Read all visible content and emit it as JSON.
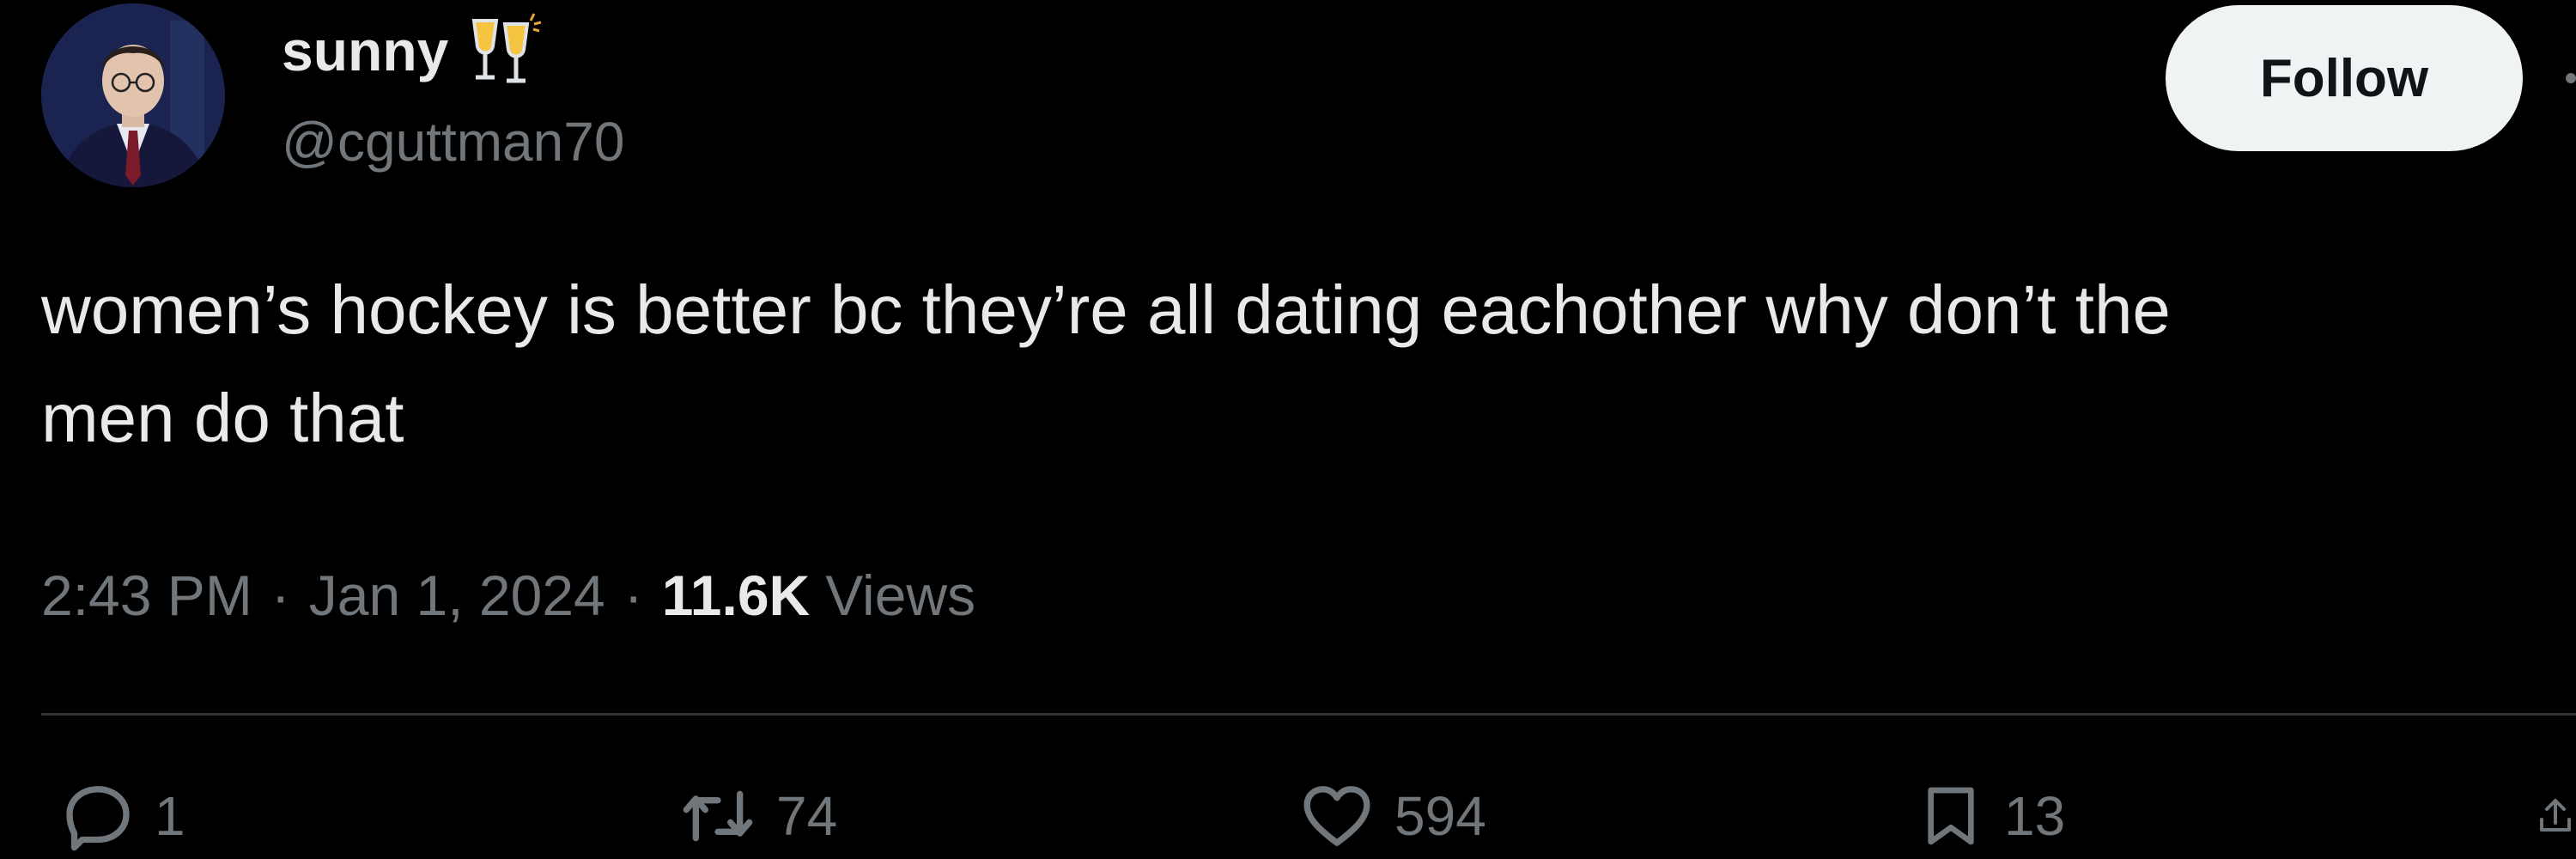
{
  "author": {
    "display_name": "sunny",
    "display_name_emoji": "clinking-glasses-emoji",
    "handle": "@cguttman70",
    "avatar": "profile-photo"
  },
  "follow_button": {
    "label": "Follow"
  },
  "tweet": {
    "text": "women’s hockey is better bc they’re all dating eachother why don’t the\nmen do that"
  },
  "meta": {
    "time": "2:43 PM",
    "separator": "·",
    "date": "Jan 1, 2024",
    "views_count": "11.6K",
    "views_label": "Views"
  },
  "actions": {
    "reply": {
      "icon": "reply-icon",
      "count": "1"
    },
    "retweet": {
      "icon": "retweet-icon",
      "count": "74"
    },
    "like": {
      "icon": "heart-icon",
      "count": "594"
    },
    "bookmark": {
      "icon": "bookmark-icon",
      "count": "13"
    },
    "share": {
      "icon": "share-icon"
    }
  },
  "colors": {
    "background": "#000000",
    "primary_text": "#e7e9ea",
    "secondary_text": "#71767b",
    "divider": "#2f3336",
    "follow_button_bg": "#eff3f4",
    "follow_button_text": "#0f1419"
  }
}
